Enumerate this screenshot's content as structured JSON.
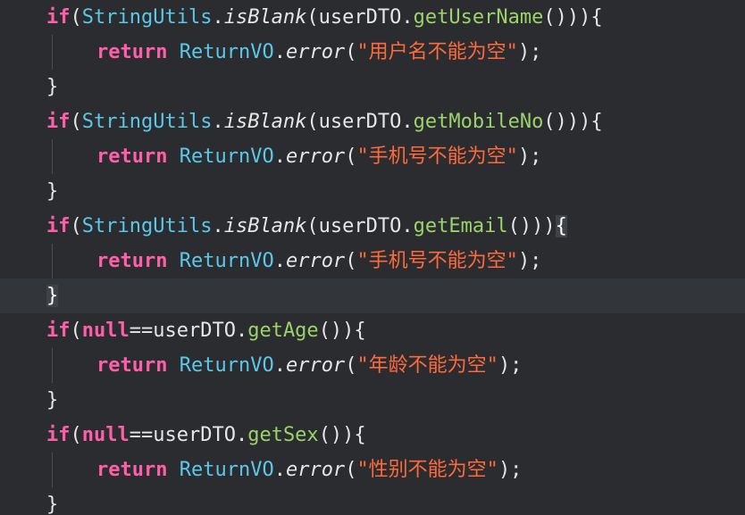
{
  "editor": {
    "theme_colors": {
      "background": "#2a2c30",
      "keyword": "#ff5fa8",
      "class": "#5cc8e8",
      "method": "#9bd36a",
      "string": "#ff6a3d",
      "text": "#e6e6e6"
    },
    "lines": [
      {
        "tokens": [
          {
            "type": "kw",
            "text": "if"
          },
          {
            "type": "punct",
            "text": "("
          },
          {
            "type": "class",
            "text": "StringUtils"
          },
          {
            "type": "punct",
            "text": "."
          },
          {
            "type": "static",
            "text": "isBlank"
          },
          {
            "type": "punct",
            "text": "("
          },
          {
            "type": "ident",
            "text": "userDTO"
          },
          {
            "type": "punct",
            "text": "."
          },
          {
            "type": "method",
            "text": "getUserName"
          },
          {
            "type": "punct",
            "text": "())){"
          }
        ]
      },
      {
        "tokens": [
          {
            "type": "return",
            "text": "return"
          },
          {
            "type": "punct",
            "text": " "
          },
          {
            "type": "class",
            "text": "ReturnVO"
          },
          {
            "type": "punct",
            "text": "."
          },
          {
            "type": "static",
            "text": "error"
          },
          {
            "type": "punct",
            "text": "("
          },
          {
            "type": "str",
            "text": "\"用户名不能为空\""
          },
          {
            "type": "punct",
            "text": ");"
          }
        ]
      },
      {
        "tokens": [
          {
            "type": "punct",
            "text": "}"
          }
        ]
      },
      {
        "tokens": [
          {
            "type": "kw",
            "text": "if"
          },
          {
            "type": "punct",
            "text": "("
          },
          {
            "type": "class",
            "text": "StringUtils"
          },
          {
            "type": "punct",
            "text": "."
          },
          {
            "type": "static",
            "text": "isBlank"
          },
          {
            "type": "punct",
            "text": "("
          },
          {
            "type": "ident",
            "text": "userDTO"
          },
          {
            "type": "punct",
            "text": "."
          },
          {
            "type": "method",
            "text": "getMobileNo"
          },
          {
            "type": "punct",
            "text": "())){"
          }
        ]
      },
      {
        "tokens": [
          {
            "type": "return",
            "text": "return"
          },
          {
            "type": "punct",
            "text": " "
          },
          {
            "type": "class",
            "text": "ReturnVO"
          },
          {
            "type": "punct",
            "text": "."
          },
          {
            "type": "static",
            "text": "error"
          },
          {
            "type": "punct",
            "text": "("
          },
          {
            "type": "str",
            "text": "\"手机号不能为空\""
          },
          {
            "type": "punct",
            "text": ");"
          }
        ]
      },
      {
        "tokens": [
          {
            "type": "punct",
            "text": "}"
          }
        ]
      },
      {
        "tokens": [
          {
            "type": "kw",
            "text": "if"
          },
          {
            "type": "punct",
            "text": "("
          },
          {
            "type": "class",
            "text": "StringUtils"
          },
          {
            "type": "punct",
            "text": "."
          },
          {
            "type": "static",
            "text": "isBlank"
          },
          {
            "type": "punct",
            "text": "("
          },
          {
            "type": "ident",
            "text": "userDTO"
          },
          {
            "type": "punct",
            "text": "."
          },
          {
            "type": "method",
            "text": "getEmail"
          },
          {
            "type": "punct",
            "text": "()))"
          },
          {
            "type": "bracket",
            "text": "{"
          }
        ]
      },
      {
        "tokens": [
          {
            "type": "return",
            "text": "return"
          },
          {
            "type": "punct",
            "text": " "
          },
          {
            "type": "class",
            "text": "ReturnVO"
          },
          {
            "type": "punct",
            "text": "."
          },
          {
            "type": "static",
            "text": "error"
          },
          {
            "type": "punct",
            "text": "("
          },
          {
            "type": "str",
            "text": "\"手机号不能为空\""
          },
          {
            "type": "punct",
            "text": ");"
          }
        ]
      },
      {
        "current": true,
        "tokens": [
          {
            "type": "bracket",
            "text": "}"
          }
        ]
      },
      {
        "tokens": [
          {
            "type": "kw",
            "text": "if"
          },
          {
            "type": "punct",
            "text": "("
          },
          {
            "type": "kw",
            "text": "null"
          },
          {
            "type": "punct",
            "text": "=="
          },
          {
            "type": "ident",
            "text": "userDTO"
          },
          {
            "type": "punct",
            "text": "."
          },
          {
            "type": "method",
            "text": "getAge"
          },
          {
            "type": "punct",
            "text": "()){"
          }
        ]
      },
      {
        "tokens": [
          {
            "type": "return",
            "text": "return"
          },
          {
            "type": "punct",
            "text": " "
          },
          {
            "type": "class",
            "text": "ReturnVO"
          },
          {
            "type": "punct",
            "text": "."
          },
          {
            "type": "static",
            "text": "error"
          },
          {
            "type": "punct",
            "text": "("
          },
          {
            "type": "str",
            "text": "\"年龄不能为空\""
          },
          {
            "type": "punct",
            "text": ");"
          }
        ]
      },
      {
        "tokens": [
          {
            "type": "punct",
            "text": "}"
          }
        ]
      },
      {
        "tokens": [
          {
            "type": "kw",
            "text": "if"
          },
          {
            "type": "punct",
            "text": "("
          },
          {
            "type": "kw",
            "text": "null"
          },
          {
            "type": "punct",
            "text": "=="
          },
          {
            "type": "ident",
            "text": "userDTO"
          },
          {
            "type": "punct",
            "text": "."
          },
          {
            "type": "method",
            "text": "getSex"
          },
          {
            "type": "punct",
            "text": "()){"
          }
        ]
      },
      {
        "tokens": [
          {
            "type": "return",
            "text": "return"
          },
          {
            "type": "punct",
            "text": " "
          },
          {
            "type": "class",
            "text": "ReturnVO"
          },
          {
            "type": "punct",
            "text": "."
          },
          {
            "type": "static",
            "text": "error"
          },
          {
            "type": "punct",
            "text": "("
          },
          {
            "type": "str",
            "text": "\"性别不能为空\""
          },
          {
            "type": "punct",
            "text": ");"
          }
        ]
      },
      {
        "tokens": [
          {
            "type": "punct",
            "text": "}"
          }
        ]
      }
    ]
  }
}
